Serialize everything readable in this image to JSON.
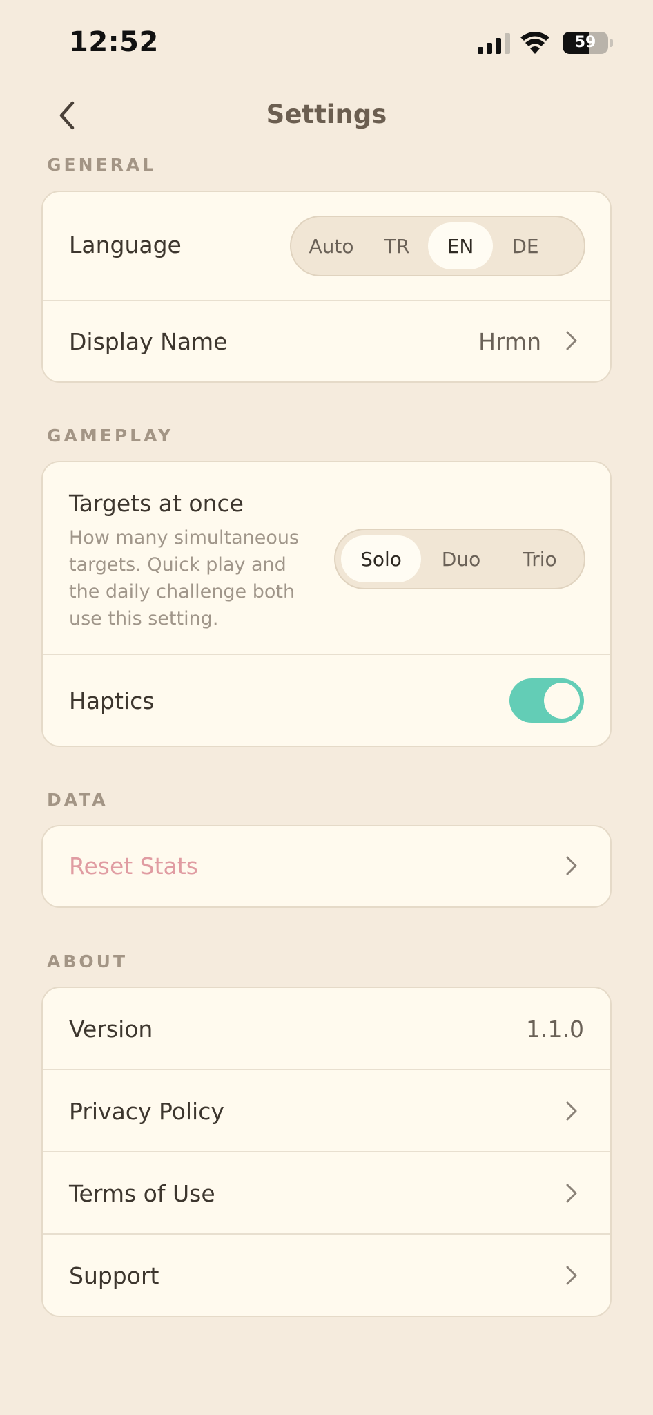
{
  "status_bar": {
    "time": "12:52",
    "battery": "59",
    "battery_level": 0.59
  },
  "nav": {
    "title": "Settings",
    "back_icon": "chevron-left-icon"
  },
  "general": {
    "header": "GENERAL",
    "language": {
      "label": "Language",
      "options": [
        "Auto",
        "TR",
        "EN",
        "DE"
      ],
      "selected": "EN"
    },
    "display_name": {
      "label": "Display Name",
      "value": "Hrmn"
    }
  },
  "gameplay": {
    "header": "GAMEPLAY",
    "targets": {
      "label": "Targets at once",
      "description": "How many simultaneous targets. Quick play and the daily challenge both use this setting.",
      "options": [
        "Solo",
        "Duo",
        "Trio"
      ],
      "selected": "Solo"
    },
    "haptics": {
      "label": "Haptics",
      "enabled": true
    }
  },
  "data": {
    "header": "DATA",
    "reset": {
      "label": "Reset Stats"
    }
  },
  "about": {
    "header": "ABOUT",
    "version": {
      "label": "Version",
      "value": "1.1.0"
    },
    "privacy": {
      "label": "Privacy Policy"
    },
    "terms": {
      "label": "Terms of Use"
    },
    "support": {
      "label": "Support"
    }
  },
  "colors": {
    "background": "#f5ebdd",
    "card": "#fffaee",
    "accent_toggle": "#63cdb6",
    "danger_text": "#e09ca2",
    "section_header": "#a39585"
  }
}
